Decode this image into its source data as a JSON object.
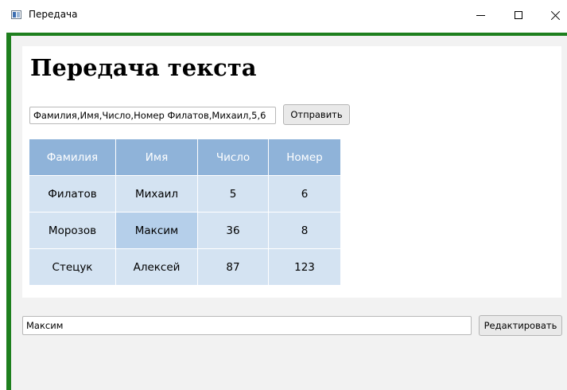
{
  "window": {
    "title": "Передача",
    "icon": "app-window-icon",
    "controls": [
      "minimize-icon",
      "maximize-icon",
      "close-icon"
    ]
  },
  "heading": "Передача текста",
  "data_input": {
    "value": "Фамилия,Имя,Число,Номер Филатов,Михаил,5,6"
  },
  "send_button": "Отправить",
  "table": {
    "headers": [
      "Фамилия",
      "Имя",
      "Число",
      "Номер"
    ],
    "rows": [
      [
        "Филатов",
        "Михаил",
        "5",
        "6"
      ],
      [
        "Морозов",
        "Максим",
        "36",
        "8"
      ],
      [
        "Стецук",
        "Алексей",
        "87",
        "123"
      ]
    ],
    "selected_cell": "Максим"
  },
  "edit_input": {
    "value": "Максим"
  },
  "edit_button": "Редактировать",
  "colors": {
    "accent_border": "#1e7f1e",
    "header_bg": "#8fb3d9",
    "cell_bg": "#d4e3f2",
    "selected_cell_bg": "#b5cfea"
  }
}
